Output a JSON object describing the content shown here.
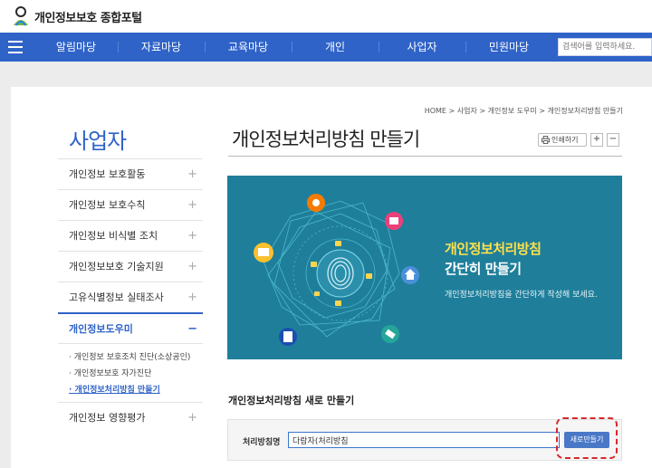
{
  "header": {
    "logo_text": "개인정보보호 종합포털",
    "search_placeholder": "검색어를 입력하세요."
  },
  "gnb": [
    "알림마당",
    "자료마당",
    "교육마당",
    "개인",
    "사업자",
    "민원마당"
  ],
  "sidebar": {
    "title": "사업자",
    "items": [
      {
        "label": "개인정보 보호활동",
        "sign": "+"
      },
      {
        "label": "개인정보 보호수칙",
        "sign": "+"
      },
      {
        "label": "개인정보 비식별 조치",
        "sign": "+"
      },
      {
        "label": "개인정보보호 기술지원",
        "sign": "+"
      },
      {
        "label": "고유식별정보 실태조사",
        "sign": "+"
      },
      {
        "label": "개인정보도우미",
        "sign": "−"
      },
      {
        "label": "개인정보 영향평가",
        "sign": "+"
      }
    ],
    "sub_items": [
      "· 개인정보 보호조치 진단(소상공인)",
      "· 개인정보보호 자가진단",
      "· 개인정보처리방침 만들기"
    ]
  },
  "breadcrumb": "HOME > 사업자 > 개인정보 도우미 > 개인정보처리방침 만들기",
  "page_title": "개인정보처리방침 만들기",
  "toolbar": {
    "print_label": "인쇄하기",
    "zoom_in": "+",
    "zoom_out": "−"
  },
  "banner": {
    "title_line1": "개인정보처리방침",
    "title_line2": "간단히 만들기",
    "description": "개인정보처리방침을 간단하게 작성해 보세요."
  },
  "form": {
    "section_title": "개인정보처리방침 새로 만들기",
    "label": "처리방침명",
    "input_value": "다람자(처리방침",
    "button_label": "새로만들기"
  },
  "colors": {
    "brand_blue": "#2f63c8",
    "banner_teal": "#1f7f9b",
    "highlight_red": "#d7282a"
  }
}
